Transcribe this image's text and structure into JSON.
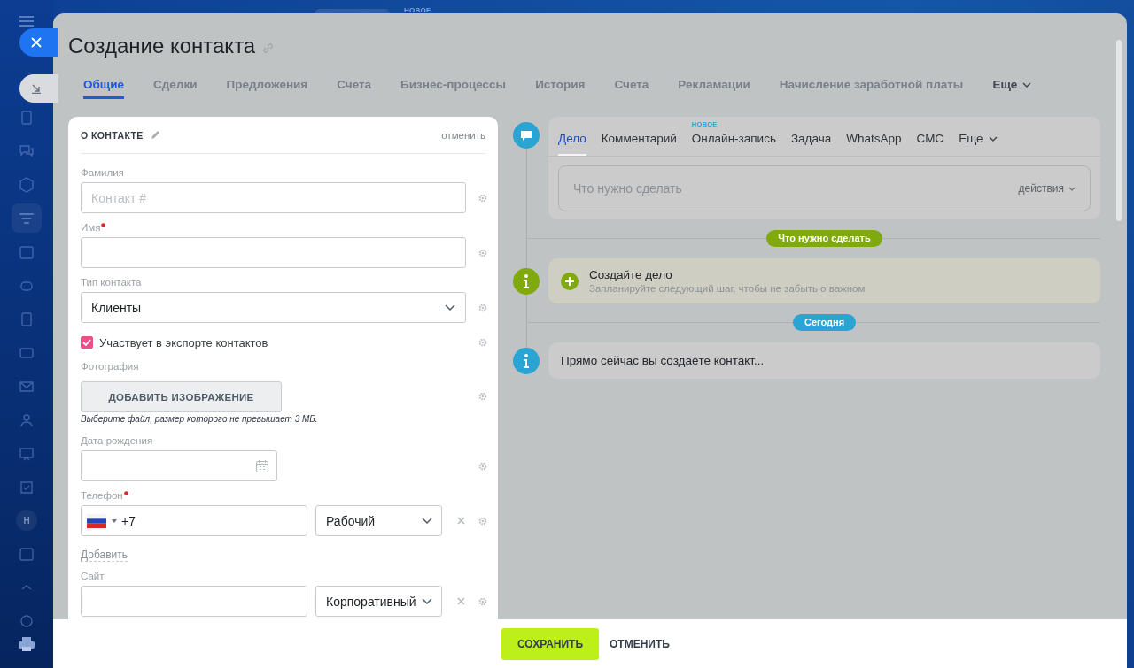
{
  "background_badge": "НОВОЕ",
  "sidebar": {
    "avatar": "H"
  },
  "title": "Создание контакта",
  "tabs": [
    {
      "label": "Общие",
      "selected": true
    },
    {
      "label": "Сделки",
      "selected": false
    },
    {
      "label": "Предложения",
      "selected": false
    },
    {
      "label": "Счета",
      "selected": false
    },
    {
      "label": "Бизнес-процессы",
      "selected": false
    },
    {
      "label": "История",
      "selected": false
    },
    {
      "label": "Счета",
      "selected": false
    },
    {
      "label": "Рекламации",
      "selected": false
    },
    {
      "label": "Начисление заработной платы",
      "selected": false
    }
  ],
  "tabs_more": "Еще",
  "section": {
    "title": "О КОНТАКТЕ",
    "cancel": "отменить"
  },
  "fields": [
    {
      "kind": "text",
      "label": "Фамилия",
      "placeholder": "Контакт #"
    },
    {
      "kind": "text",
      "label": "Имя",
      "required": true
    },
    {
      "kind": "select",
      "label": "Тип контакта",
      "value": "Клиенты"
    },
    {
      "kind": "checkbox",
      "label": "Участвует в экспорте контактов",
      "checked": true
    },
    {
      "kind": "image",
      "label": "Фотография",
      "button": "ДОБАВИТЬ ИЗОБРАЖЕНИЕ",
      "hint": "Выберите файл, размер которого не превышает 3 МБ."
    },
    {
      "kind": "date",
      "label": "Дата рождения"
    },
    {
      "kind": "phone",
      "label": "Телефон",
      "required": true,
      "value": "+7",
      "type": "Рабочий",
      "add": "Добавить"
    },
    {
      "kind": "site",
      "label": "Сайт",
      "type": "Корпоративный"
    }
  ],
  "activity": {
    "tabs": [
      {
        "label": "Дело",
        "selected": true
      },
      {
        "label": "Комментарий",
        "selected": false
      },
      {
        "label": "Онлайн-запись",
        "selected": false,
        "badge": "НОВОЕ"
      },
      {
        "label": "Задача",
        "selected": false
      },
      {
        "label": "WhatsApp",
        "selected": false
      },
      {
        "label": "СМС",
        "selected": false
      }
    ],
    "more": "Еще",
    "placeholder": "Что нужно сделать",
    "actions": "действия"
  },
  "timeline": [
    {
      "kind": "divider",
      "label": "Что нужно сделать",
      "color": "#7fa90c"
    },
    {
      "kind": "todo",
      "title": "Создайте дело",
      "subtitle": "Запланируйте следующий шаг, чтобы не забыть о важном"
    },
    {
      "kind": "divider",
      "label": "Сегодня",
      "color": "#2aa4d2"
    },
    {
      "kind": "info",
      "text": "Прямо сейчас вы создаёте контакт..."
    }
  ],
  "footer": {
    "save": "СОХРАНИТЬ",
    "cancel": "ОТМЕНИТЬ"
  }
}
